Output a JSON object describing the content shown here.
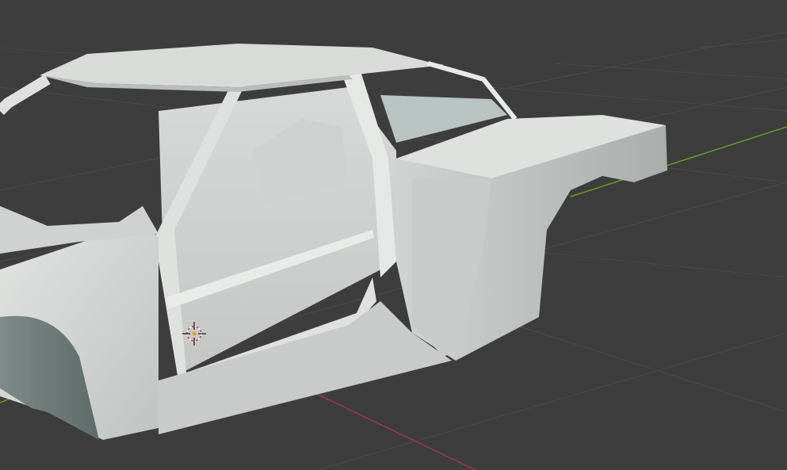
{
  "viewport": {
    "background_color": "#3d3d3d",
    "grid_color": "#484848",
    "x_axis_color": "#9a3a47",
    "y_axis_color": "#6a9a2a",
    "body_color": "#d4d6d4",
    "cursor_icon": "3d-cursor-icon"
  }
}
